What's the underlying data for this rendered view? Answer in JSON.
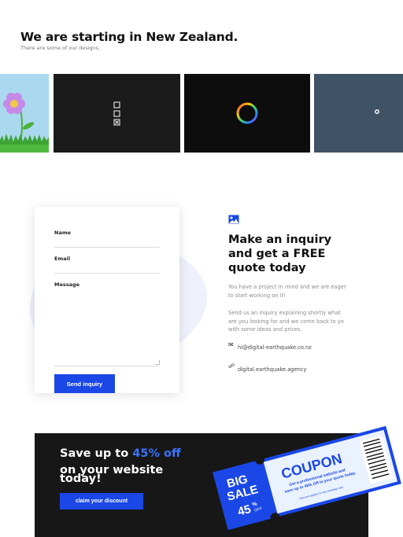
{
  "hero": {
    "title": "We are starting in New Zealand.",
    "subtitle": "There are some of our designs."
  },
  "gallery": {
    "tiles": [
      {
        "name": "flower-design",
        "color": "#aad8ef"
      },
      {
        "name": "minimal-icons-design",
        "color": "#1b1b1b"
      },
      {
        "name": "ring-design",
        "color": "#0d0d0d"
      },
      {
        "name": "dot-design",
        "color": "#3f5266"
      }
    ]
  },
  "form": {
    "name_label": "Name",
    "email_label": "Email",
    "message_label": "Message",
    "send_label": "Send inquiry"
  },
  "inquiry": {
    "icon": "image-icon",
    "title": "Make an inquiry and get a FREE quote today",
    "paragraph1": "You have a project in mind and we are eager to start working on it!",
    "paragraph2": "Send us an inquiry explaining shortly what are you looking for and we come back to yo with some ideas and prices.",
    "email": "hi@digital-earthquake.co.nz",
    "website": "digital.earthquake.agency"
  },
  "promo": {
    "save_prefix": "Save up to ",
    "save_percent": "45% off",
    "save_line2": "on your website today!",
    "claim_label": "claim your discount",
    "coupon": {
      "big": "BIG",
      "sale": "SALE",
      "percent": "45",
      "percent_sign": "%",
      "off": "OFF",
      "heading": "COUPON",
      "line1": "Get a professional website and",
      "line2": "save up to 45% Off in your quote today.",
      "fine_print": "Discount applies to new bookings only"
    }
  },
  "colors": {
    "accent": "#1a47e6",
    "accent_text": "#3b73ff",
    "banner_bg": "#171717"
  }
}
